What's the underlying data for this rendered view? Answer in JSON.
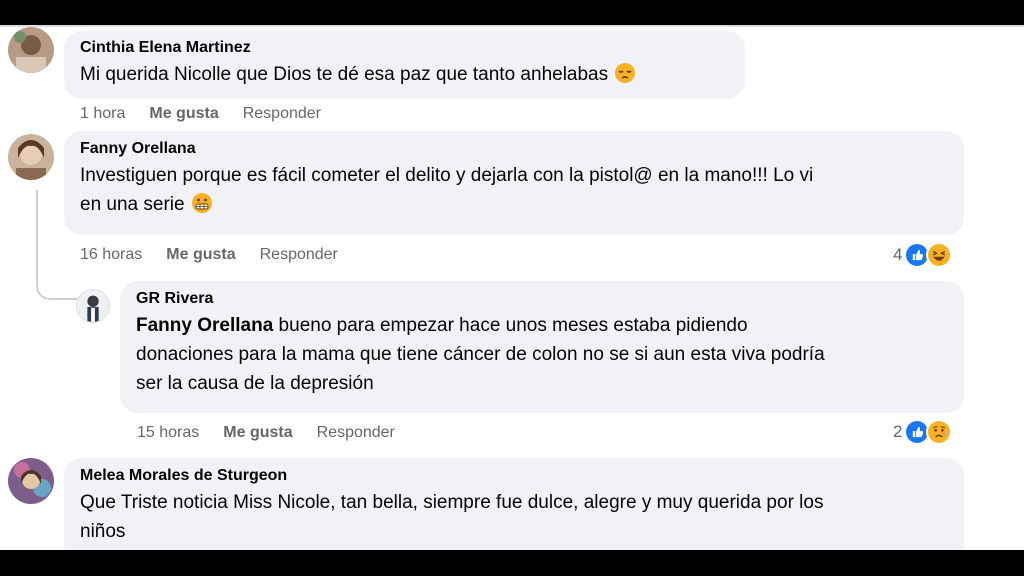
{
  "comments": [
    {
      "author": "Cinthia Elena Martinez",
      "text": "Mi querida Nicolle que Dios te dé esa paz que tanto anhelabas",
      "emoji": "pensive-face-emoji",
      "time": "1 hora",
      "like_label": "Me gusta",
      "reply_label": "Responder"
    },
    {
      "author": "Fanny Orellana",
      "text_line1": "Investiguen porque es fácil cometer el delito y dejarla con la pistol@ en la mano!!! Lo vi",
      "text_line2": "en una serie",
      "emoji": "grimacing-face-emoji",
      "time": "16 horas",
      "like_label": "Me gusta",
      "reply_label": "Responder",
      "reaction_count": "4",
      "reactions": [
        "like-reaction-icon",
        "haha-reaction-icon"
      ]
    },
    {
      "author": "GR Rivera",
      "mention": "Fanny Orellana",
      "text_line1": " bueno para empezar hace unos meses estaba pidiendo",
      "text_line2": "donaciones para la mama que tiene cáncer de colon no se si aun esta viva podría",
      "text_line3": "ser la causa de la depresión",
      "time": "15 horas",
      "like_label": "Me gusta",
      "reply_label": "Responder",
      "reaction_count": "2",
      "reactions": [
        "like-reaction-icon",
        "sad-reaction-icon"
      ]
    },
    {
      "author": "Melea Morales de Sturgeon",
      "text_line1": "Que Triste noticia Miss Nicole, tan bella, siempre fue dulce, alegre y muy querida por los",
      "text_line2": "niños"
    }
  ],
  "colors": {
    "bubble": "#f0f2f5",
    "meta_text": "#65676b",
    "like_blue": "#1877f2",
    "reaction_yellow": "#f7b125"
  }
}
